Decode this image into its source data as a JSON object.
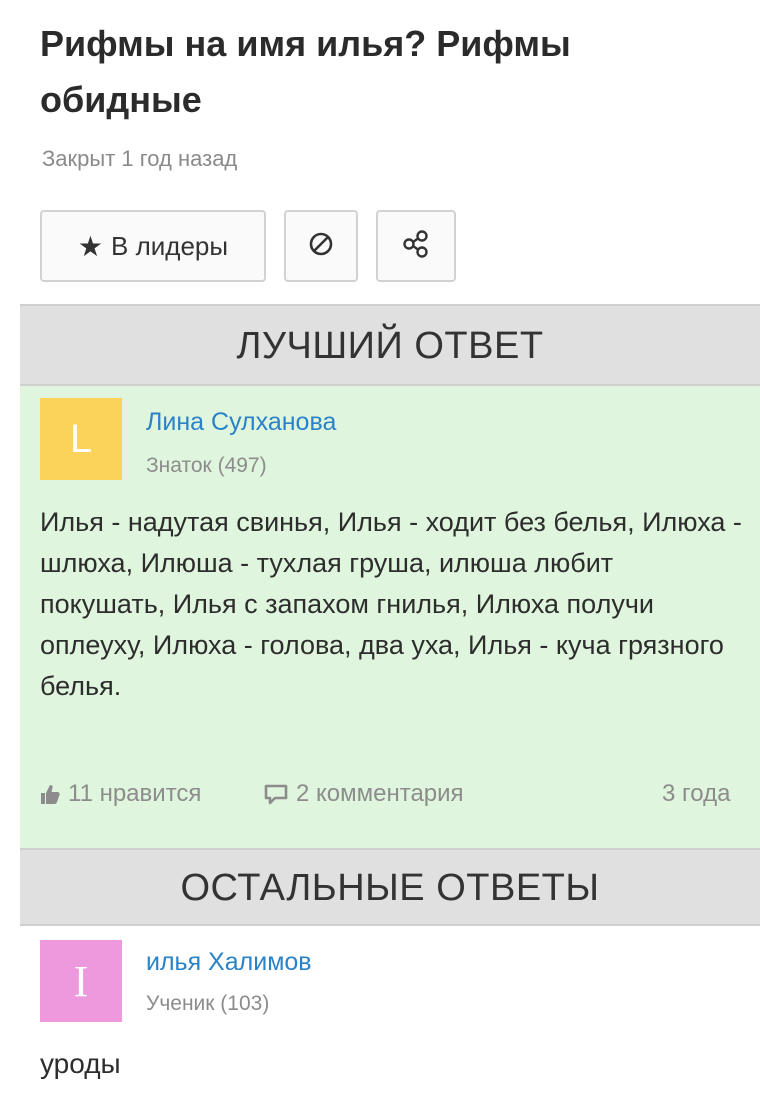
{
  "question": {
    "title": "Рифмы на имя илья? Рифмы обидные",
    "status": "Закрыт 1 год назад"
  },
  "actions": {
    "leaders_label": "В лидеры",
    "report_icon": "ban-icon",
    "share_icon": "share-icon"
  },
  "best_section": {
    "header": "ЛУЧШИЙ ОТВЕТ",
    "author": {
      "avatar_letter": "L",
      "avatar_color": "#fcd35a",
      "name": "Лина Сулханова",
      "rank": "Знаток (497)"
    },
    "text": "Илья - надутая свинья, Илья - ходит без белья, Илюха - шлюха, Илюша - тухлая груша, илюша любит покушать, Илья с запахом гнилья, Илюха получи оплеуху, Илюха - голова, два уха, Илья - куча грязного белья.",
    "likes": "11 нравится",
    "comments": "2 комментария",
    "age": "3 года",
    "background_color": "#e0f5dd"
  },
  "others_section": {
    "header": "ОСТАЛЬНЫЕ ОТВЕТЫ",
    "answers": [
      {
        "avatar_letter": "I",
        "avatar_color": "#ee99dd",
        "name": "илья Халимов",
        "rank": "Ученик (103)",
        "text": "уроды"
      }
    ]
  },
  "colors": {
    "link": "#2a82c9",
    "muted": "#8c8c8c",
    "section_header_bg": "#e0e0e0"
  }
}
